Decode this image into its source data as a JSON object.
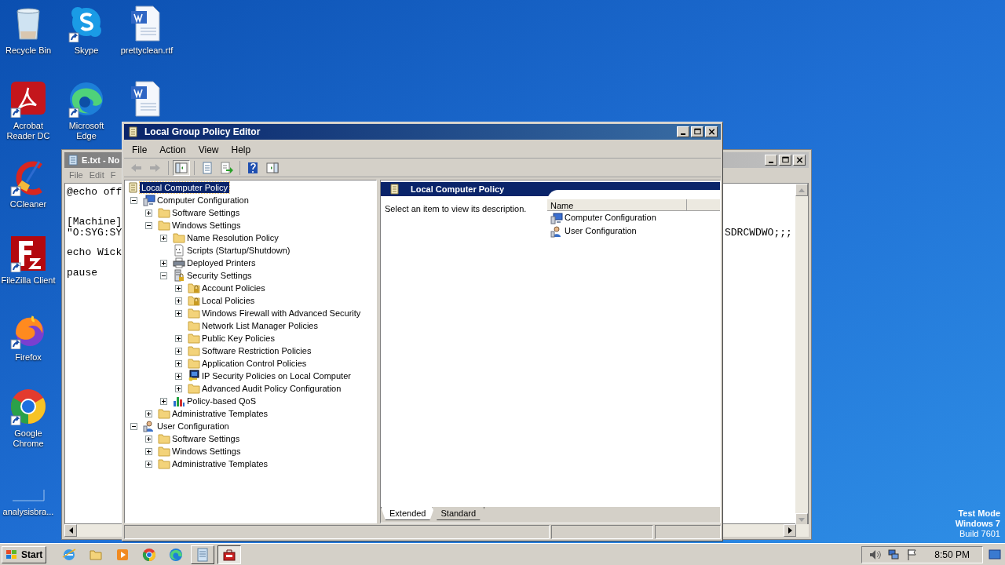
{
  "desktop_icons": [
    {
      "label": "Recycle Bin",
      "kind": "recycle",
      "shortcut": false
    },
    {
      "label": "Skype",
      "kind": "chat",
      "shortcut": true
    },
    {
      "label": "prettyclean.rtf",
      "kind": "document",
      "shortcut": false
    },
    {
      "label": "Acrobat Reader DC",
      "kind": "reader",
      "shortcut": true
    },
    {
      "label": "Microsoft Edge",
      "kind": "wave",
      "shortcut": true
    },
    {
      "kind": "document",
      "shortcut": false
    },
    {
      "label": "CCleaner",
      "kind": "cleaner",
      "shortcut": true
    },
    {
      "label": "FileZilla Client",
      "kind": "ftp",
      "shortcut": true
    },
    {
      "label": "Firefox",
      "kind": "fox",
      "shortcut": true
    },
    {
      "label": "Google Chrome",
      "kind": "ring",
      "shortcut": true
    },
    {
      "label": "analysisbra...",
      "kind": "blank",
      "shortcut": false
    }
  ],
  "notepad": {
    "title": "E.txt - No",
    "menu": [
      "File",
      "Edit",
      "F"
    ],
    "lines": [
      "@echo off",
      "[Machine]",
      "\"O:SYG:SY",
      "echo Wick",
      "pause"
    ],
    "line_right": "SDRCWDWO;;;"
  },
  "editor": {
    "title": "Local Group Policy Editor",
    "menu": [
      "File",
      "Action",
      "View",
      "Help"
    ],
    "toolbar": [
      {
        "kind": "back",
        "disabled": true
      },
      {
        "kind": "forward",
        "disabled": true
      },
      {
        "kind": "tree",
        "pressed": true
      },
      {
        "kind": "export"
      },
      {
        "kind": "list"
      },
      {
        "kind": "help"
      },
      {
        "kind": "action_pane"
      }
    ],
    "tree": [
      {
        "label": "Local Computer Policy",
        "kind": "policy",
        "selected": true,
        "children": [
          {
            "label": "Computer Configuration",
            "kind": "computer",
            "selected": false,
            "expanded": true,
            "children": [
              {
                "label": "Software Settings",
                "kind": "folder",
                "selected": false,
                "expanded": false
              },
              {
                "label": "Windows Settings",
                "kind": "folder",
                "selected": false,
                "expanded": true,
                "children": [
                  {
                    "label": "Name Resolution Policy",
                    "kind": "folder",
                    "selected": false,
                    "expanded": false
                  },
                  {
                    "label": "Scripts (Startup/Shutdown)",
                    "kind": "scripts",
                    "selected": false
                  },
                  {
                    "label": "Deployed Printers",
                    "kind": "printer",
                    "selected": false,
                    "expanded": false
                  },
                  {
                    "label": "Security Settings",
                    "kind": "security",
                    "selected": false,
                    "expanded": true,
                    "children": [
                      {
                        "label": "Account Policies",
                        "kind": "folder_lock",
                        "selected": false,
                        "expanded": false
                      },
                      {
                        "label": "Local Policies",
                        "kind": "folder_lock",
                        "selected": false,
                        "expanded": false
                      },
                      {
                        "label": "Windows Firewall with Advanced Security",
                        "kind": "folder",
                        "selected": false,
                        "expanded": false
                      },
                      {
                        "label": "Network List Manager Policies",
                        "kind": "folder",
                        "selected": false
                      },
                      {
                        "label": "Public Key Policies",
                        "kind": "folder",
                        "selected": false,
                        "expanded": false
                      },
                      {
                        "label": "Software Restriction Policies",
                        "kind": "folder",
                        "selected": false,
                        "expanded": false
                      },
                      {
                        "label": "Application Control Policies",
                        "kind": "folder",
                        "selected": false,
                        "expanded": false
                      },
                      {
                        "label": "IP Security Policies on Local Computer",
                        "kind": "ip_security",
                        "selected": false,
                        "expanded": false
                      },
                      {
                        "label": "Advanced Audit Policy Configuration",
                        "kind": "folder",
                        "selected": false,
                        "expanded": false
                      }
                    ]
                  },
                  {
                    "label": "Policy-based QoS",
                    "kind": "qos",
                    "selected": false,
                    "expanded": false
                  }
                ]
              },
              {
                "label": "Administrative Templates",
                "kind": "folder",
                "selected": false,
                "expanded": false
              }
            ]
          },
          {
            "label": "User Configuration",
            "kind": "user",
            "selected": false,
            "expanded": true,
            "children": [
              {
                "label": "Software Settings",
                "kind": "folder",
                "selected": false,
                "expanded": false
              },
              {
                "label": "Windows Settings",
                "kind": "folder",
                "selected": false,
                "expanded": false
              },
              {
                "label": "Administrative Templates",
                "kind": "folder",
                "selected": false,
                "expanded": false
              }
            ]
          }
        ]
      }
    ],
    "details": {
      "heading": "Local Computer Policy",
      "description": "Select an item to view its description.",
      "columns": [
        "Name"
      ],
      "items": [
        {
          "label": "Computer Configuration",
          "kind": "computer"
        },
        {
          "label": "User Configuration",
          "kind": "user"
        }
      ]
    },
    "view_tabs": [
      {
        "label": "Extended",
        "selected": true
      },
      {
        "label": "Standard",
        "selected": false
      }
    ]
  },
  "taskbar": {
    "start": "Start",
    "apps": [
      {
        "kind": "browser_e",
        "active": false
      },
      {
        "kind": "folder",
        "active": false
      },
      {
        "kind": "media",
        "active": false
      },
      {
        "kind": "ring",
        "active": false
      },
      {
        "kind": "wave",
        "active": false
      },
      {
        "kind": "notepad",
        "active": false
      },
      {
        "kind": "policy",
        "active": true
      }
    ],
    "clock": "8:50 PM"
  },
  "os_notice": [
    "Test Mode",
    "Windows 7",
    "Build 7601"
  ]
}
